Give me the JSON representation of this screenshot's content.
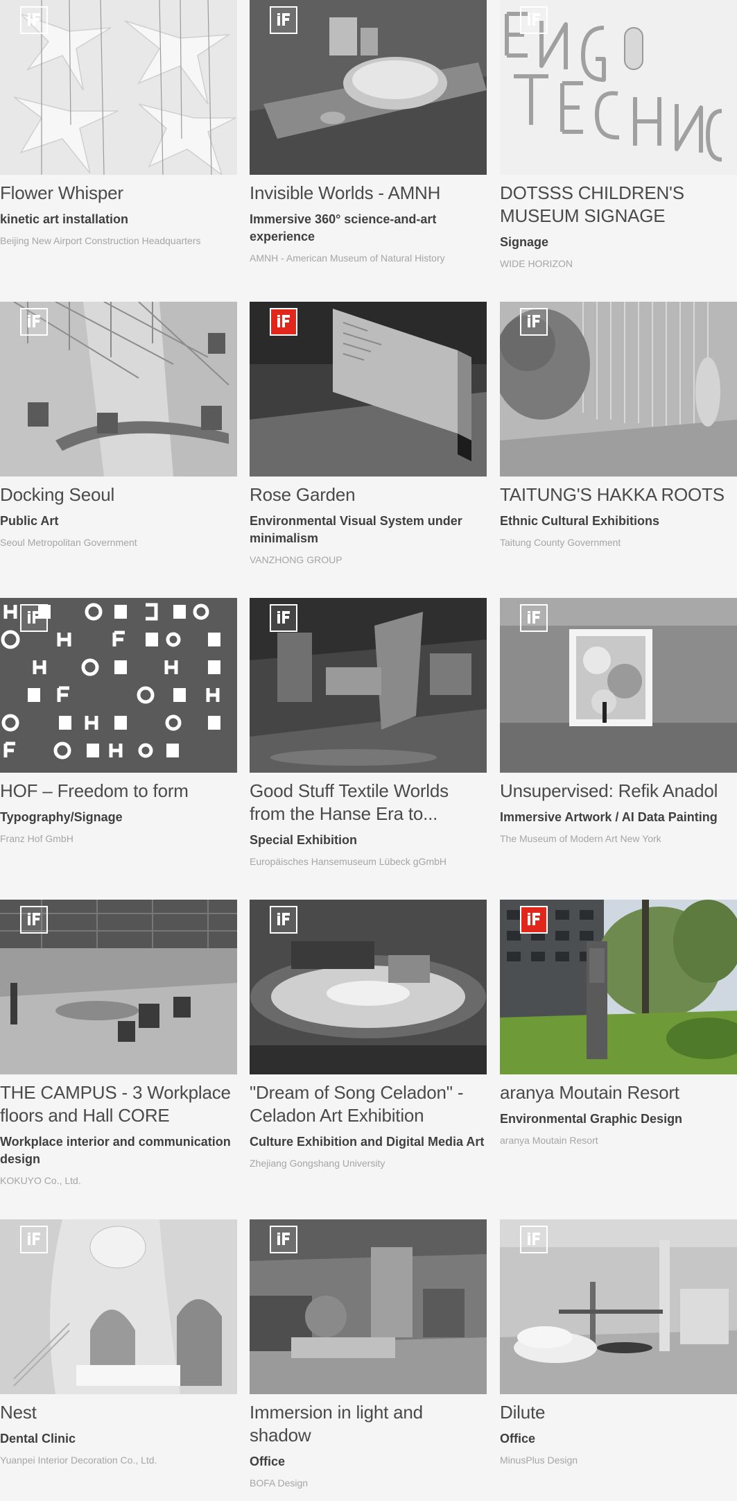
{
  "badge_label": "iF",
  "colors": {
    "badge_red": "#e1261c",
    "background": "#f5f5f5"
  },
  "projects": [
    {
      "title": "Flower Whisper",
      "category": "kinetic art installation",
      "client": "Beijing New Airport Construction Headquarters",
      "badge": "outline"
    },
    {
      "title": "Invisible Worlds - AMNH",
      "category": "Immersive 360° science-and-art experience",
      "client": "AMNH - American Museum of Natural History",
      "badge": "outline"
    },
    {
      "title": "DOTSSS CHILDREN'S MUSEUM SIGNAGE",
      "category": "Signage",
      "client": "WIDE HORIZON",
      "badge": "outline"
    },
    {
      "title": "Docking Seoul",
      "category": "Public Art",
      "client": "Seoul Metropolitan Government",
      "badge": "outline"
    },
    {
      "title": "Rose Garden",
      "category": "Environmental Visual System under minimalism",
      "client": "VANZHONG GROUP",
      "badge": "gold"
    },
    {
      "title": "TAITUNG'S HAKKA ROOTS",
      "category": "Ethnic Cultural Exhibitions",
      "client": "Taitung County Government",
      "badge": "outline"
    },
    {
      "title": "HOF – Freedom to form",
      "category": "Typography/Signage",
      "client": "Franz Hof GmbH",
      "badge": "outline"
    },
    {
      "title": "Good Stuff Textile Worlds from the Hanse Era to...",
      "category": "Special Exhibition",
      "client": "Europäisches Hansemuseum Lübeck gGmbH",
      "badge": "outline"
    },
    {
      "title": "Unsupervised: Refik Anadol",
      "category": "Immersive Artwork / AI Data Painting",
      "client": "The Museum of Modern Art New York",
      "badge": "outline"
    },
    {
      "title": "THE CAMPUS - 3 Workplace floors and Hall CORE",
      "category": "Workplace interior and communication design",
      "client": "KOKUYO Co., Ltd.",
      "badge": "outline"
    },
    {
      "title": "\"Dream of Song Celadon\" - Celadon Art Exhibition",
      "category": "Culture Exhibition and Digital Media Art",
      "client": "Zhejiang Gongshang University",
      "badge": "outline"
    },
    {
      "title": "aranya Moutain Resort",
      "category": "Environmental Graphic Design",
      "client": "aranya Moutain Resort",
      "badge": "gold"
    },
    {
      "title": "Nest",
      "category": "Dental Clinic",
      "client": "Yuanpei Interior Decoration Co., Ltd.",
      "badge": "outline"
    },
    {
      "title": "Immersion in light and shadow",
      "category": "Office",
      "client": "BOFA Design",
      "badge": "outline"
    },
    {
      "title": "Dilute",
      "category": "Office",
      "client": "MinusPlus Design",
      "badge": "outline"
    }
  ]
}
